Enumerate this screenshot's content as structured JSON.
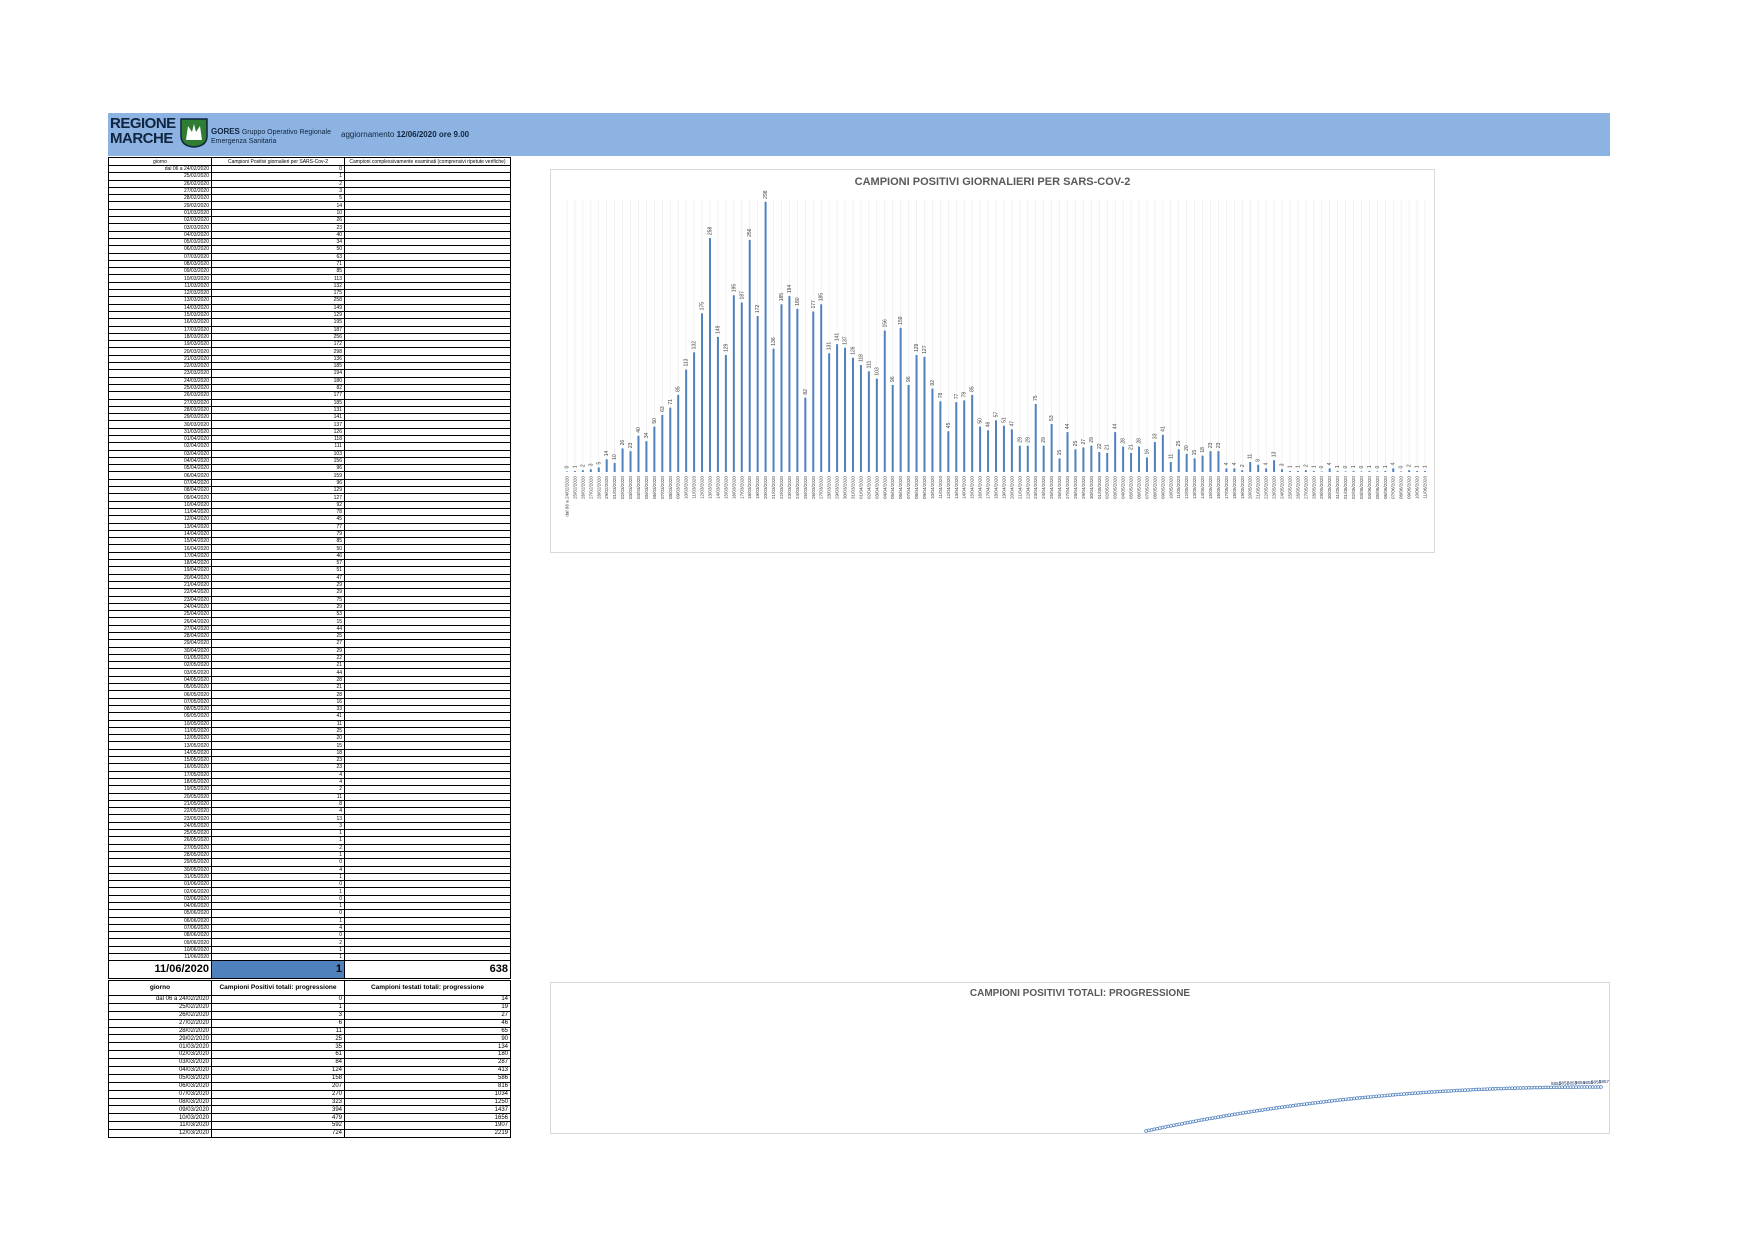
{
  "header": {
    "logo_text": [
      "REGIONE",
      "MARCHE"
    ],
    "gores_title": "GORES",
    "gores_sub1": "Gruppo Operativo Regionale",
    "gores_sub2": "Emergenza Sanitaria",
    "update_label": "aggiornamento",
    "update_value": "12/06/2020 ore 9.00"
  },
  "colors": {
    "banner": "#8db3e2",
    "bar": "#4f81bd",
    "highlight": "#4f81bd"
  },
  "table1": {
    "col_giorno": "giorno",
    "col_positivi": "Campioni Positivi giornalieri per SARS-Cov-2",
    "col_campioni": "Campioni complessivamente esaminati (comprensivi ripetute verifiche)",
    "first_label": "dal 06 a 24/02/2020",
    "last_label": "11/06/2020",
    "last_positive": "1",
    "last_campioni": "638"
  },
  "table2": {
    "col_giorno": "giorno",
    "col_positivi": "Campioni Positivi totali: progressione",
    "col_campioni": "Campioni testati totali: progressione",
    "rows": [
      [
        "dal 06 a 24/02/2020",
        "0",
        "14"
      ],
      [
        "25/02/2020",
        "1",
        "19"
      ],
      [
        "26/02/2020",
        "3",
        "27"
      ],
      [
        "27/02/2020",
        "6",
        "46"
      ],
      [
        "28/02/2020",
        "11",
        "65"
      ],
      [
        "29/02/2020",
        "25",
        "90"
      ],
      [
        "01/03/2020",
        "35",
        "134"
      ],
      [
        "02/03/2020",
        "61",
        "180"
      ],
      [
        "03/03/2020",
        "84",
        "287"
      ],
      [
        "04/03/2020",
        "124",
        "413"
      ],
      [
        "05/03/2020",
        "158",
        "586"
      ],
      [
        "06/03/2020",
        "207",
        "816"
      ],
      [
        "07/03/2020",
        "270",
        "1034"
      ],
      [
        "08/03/2020",
        "323",
        "1250"
      ],
      [
        "09/03/2020",
        "394",
        "1437"
      ],
      [
        "10/03/2020",
        "479",
        "1656"
      ],
      [
        "11/03/2020",
        "592",
        "1907"
      ],
      [
        "12/03/2020",
        "724",
        "2219"
      ]
    ]
  },
  "chart_data": [
    {
      "type": "bar",
      "title": "CAMPIONI POSITIVI GIORNALIERI PER SARS-COV-2",
      "first_category": "dal 06 a 24/02/2020",
      "start_date": "2020-02-25",
      "values": [
        0,
        1,
        2,
        3,
        5,
        14,
        10,
        26,
        23,
        40,
        34,
        50,
        63,
        71,
        85,
        113,
        132,
        175,
        258,
        149,
        129,
        195,
        187,
        256,
        172,
        298,
        136,
        185,
        194,
        180,
        82,
        177,
        185,
        131,
        141,
        137,
        126,
        118,
        111,
        103,
        156,
        96,
        159,
        96,
        129,
        127,
        92,
        78,
        45,
        77,
        79,
        85,
        50,
        46,
        57,
        51,
        47,
        29,
        29,
        75,
        29,
        53,
        15,
        44,
        25,
        27,
        29,
        22,
        21,
        44,
        28,
        21,
        28,
        16,
        33,
        41,
        11,
        25,
        20,
        15,
        18,
        23,
        23,
        4,
        4,
        2,
        11,
        8,
        4,
        13,
        3,
        1,
        1,
        2,
        1,
        0,
        4,
        1,
        0,
        1,
        0,
        1,
        0,
        1,
        4,
        0,
        2,
        1,
        1
      ],
      "ylim": [
        0,
        300
      ]
    },
    {
      "type": "line",
      "title": "CAMPIONI POSITIVI TOTALI: PROGRESSIONE",
      "visible_values": [
        5852,
        5852,
        5853,
        5854,
        5855,
        5856,
        5857
      ]
    }
  ]
}
